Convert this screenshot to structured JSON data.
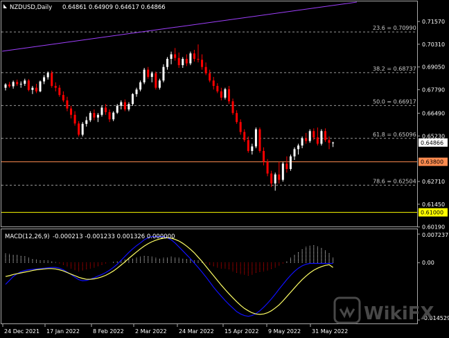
{
  "header": {
    "symbol": "NZDUSD,Daily",
    "ohlc": "0.64861 0.64909 0.64617 0.64866"
  },
  "macd_header": {
    "label": "MACD(12,26,9)",
    "values": "-0.000213 -0.001233 0.001326 0.000000"
  },
  "watermark": {
    "text": "WikiFX"
  },
  "colors": {
    "background": "#000000",
    "bull": "#ffffff",
    "bear": "#ff0000",
    "trendline": "#a040ff",
    "support": "#ff8c50",
    "support2": "#ffff00",
    "macd_line": "#1010ff",
    "signal_line": "#ffff66"
  },
  "chart_data": [
    {
      "type": "candlestick",
      "ylim": [
        0.61,
        0.716
      ],
      "price_axis_ticks": [
        {
          "value": 0.7157,
          "label": "0.71570"
        },
        {
          "value": 0.7031,
          "label": "0.70310"
        },
        {
          "value": 0.6905,
          "label": "0.69050"
        },
        {
          "value": 0.6779,
          "label": "0.67790"
        },
        {
          "value": 0.6649,
          "label": "0.66490"
        },
        {
          "value": 0.6523,
          "label": "0.65230"
        },
        {
          "value": 0.6271,
          "label": "0.62710"
        },
        {
          "value": 0.6145,
          "label": "0.61450"
        },
        {
          "value": 0.6019,
          "label": "0.60190"
        }
      ],
      "current_price": {
        "value": 0.64866,
        "label": "0.64866"
      },
      "fib_levels": [
        {
          "name": "23.6",
          "value": 0.7099,
          "label": "23.6 = 0.70990"
        },
        {
          "name": "38.2",
          "value": 0.68737,
          "label": "38.2 = 0.68737"
        },
        {
          "name": "50.0",
          "value": 0.66917,
          "label": "50.0 = 0.66917"
        },
        {
          "name": "61.8",
          "value": 0.65096,
          "label": "61.8 = 0.65096"
        },
        {
          "name": "78.6",
          "value": 0.62504,
          "label": "78.6 = 0.62504"
        }
      ],
      "horizontal_lines": [
        {
          "value": 0.638,
          "label": "0.63800"
        },
        {
          "value": 0.61,
          "label": "0.61000"
        }
      ],
      "x_labels": [
        "24 Dec 2021",
        "17 Jan 2022",
        "8 Feb 2022",
        "2 Mar 2022",
        "24 Mar 2022",
        "15 Apr 2022",
        "9 May 2022",
        "31 May 2022"
      ],
      "candles": [
        [
          0.679,
          0.6815,
          0.6775,
          0.6808
        ],
        [
          0.6808,
          0.6822,
          0.679,
          0.6798
        ],
        [
          0.6798,
          0.683,
          0.6785,
          0.6822
        ],
        [
          0.6822,
          0.6835,
          0.68,
          0.681
        ],
        [
          0.681,
          0.6825,
          0.679,
          0.6812
        ],
        [
          0.6812,
          0.684,
          0.68,
          0.683
        ],
        [
          0.683,
          0.6838,
          0.677,
          0.6778
        ],
        [
          0.6778,
          0.68,
          0.6755,
          0.679
        ],
        [
          0.679,
          0.6812,
          0.676,
          0.677
        ],
        [
          0.677,
          0.683,
          0.6765,
          0.6825
        ],
        [
          0.6825,
          0.686,
          0.681,
          0.6848
        ],
        [
          0.6848,
          0.688,
          0.6835,
          0.6872
        ],
        [
          0.6872,
          0.6885,
          0.679,
          0.68
        ],
        [
          0.68,
          0.682,
          0.677,
          0.679
        ],
        [
          0.679,
          0.6805,
          0.674,
          0.675
        ],
        [
          0.675,
          0.677,
          0.671,
          0.672
        ],
        [
          0.672,
          0.674,
          0.666,
          0.6675
        ],
        [
          0.6675,
          0.669,
          0.662,
          0.664
        ],
        [
          0.664,
          0.666,
          0.658,
          0.6592
        ],
        [
          0.6592,
          0.6605,
          0.652,
          0.653
        ],
        [
          0.653,
          0.66,
          0.652,
          0.659
        ],
        [
          0.659,
          0.663,
          0.6575,
          0.661
        ],
        [
          0.661,
          0.666,
          0.66,
          0.665
        ],
        [
          0.665,
          0.667,
          0.661,
          0.6625
        ],
        [
          0.6625,
          0.665,
          0.66,
          0.664
        ],
        [
          0.664,
          0.669,
          0.663,
          0.668
        ],
        [
          0.668,
          0.67,
          0.664,
          0.6655
        ],
        [
          0.6655,
          0.667,
          0.66,
          0.6615
        ],
        [
          0.6615,
          0.666,
          0.6605,
          0.6652
        ],
        [
          0.6652,
          0.67,
          0.6645,
          0.669
        ],
        [
          0.669,
          0.672,
          0.667,
          0.671
        ],
        [
          0.671,
          0.6725,
          0.666,
          0.667
        ],
        [
          0.667,
          0.671,
          0.666,
          0.67
        ],
        [
          0.67,
          0.676,
          0.669,
          0.6755
        ],
        [
          0.6755,
          0.679,
          0.674,
          0.678
        ],
        [
          0.678,
          0.683,
          0.677,
          0.682
        ],
        [
          0.682,
          0.69,
          0.681,
          0.689
        ],
        [
          0.689,
          0.6905,
          0.684,
          0.685
        ],
        [
          0.685,
          0.688,
          0.682,
          0.687
        ],
        [
          0.687,
          0.688,
          0.678,
          0.679
        ],
        [
          0.679,
          0.684,
          0.678,
          0.683
        ],
        [
          0.683,
          0.692,
          0.682,
          0.6905
        ],
        [
          0.6905,
          0.696,
          0.689,
          0.695
        ],
        [
          0.695,
          0.699,
          0.692,
          0.6975
        ],
        [
          0.6975,
          0.701,
          0.694,
          0.6955
        ],
        [
          0.6955,
          0.6985,
          0.69,
          0.6915
        ],
        [
          0.6915,
          0.696,
          0.69,
          0.695
        ],
        [
          0.695,
          0.6975,
          0.691,
          0.6925
        ],
        [
          0.6925,
          0.699,
          0.6915,
          0.698
        ],
        [
          0.698,
          0.7,
          0.6935,
          0.695
        ],
        [
          0.695,
          0.703,
          0.693,
          0.6945
        ],
        [
          0.6945,
          0.6975,
          0.689,
          0.6905
        ],
        [
          0.6905,
          0.693,
          0.686,
          0.687
        ],
        [
          0.687,
          0.689,
          0.682,
          0.683
        ],
        [
          0.683,
          0.685,
          0.678,
          0.68
        ],
        [
          0.68,
          0.6815,
          0.676,
          0.677
        ],
        [
          0.677,
          0.679,
          0.672,
          0.6735
        ],
        [
          0.6735,
          0.679,
          0.6725,
          0.6782
        ],
        [
          0.6782,
          0.68,
          0.67,
          0.6715
        ],
        [
          0.6715,
          0.673,
          0.664,
          0.665
        ],
        [
          0.665,
          0.6665,
          0.659,
          0.66
        ],
        [
          0.66,
          0.6615,
          0.653,
          0.6545
        ],
        [
          0.6545,
          0.656,
          0.649,
          0.65
        ],
        [
          0.65,
          0.652,
          0.643,
          0.644
        ],
        [
          0.644,
          0.648,
          0.642,
          0.6465
        ],
        [
          0.6465,
          0.657,
          0.6455,
          0.656
        ],
        [
          0.656,
          0.657,
          0.643,
          0.644
        ],
        [
          0.644,
          0.646,
          0.636,
          0.638
        ],
        [
          0.638,
          0.6395,
          0.63,
          0.6315
        ],
        [
          0.6315,
          0.633,
          0.624,
          0.626
        ],
        [
          0.626,
          0.632,
          0.622,
          0.631
        ],
        [
          0.631,
          0.638,
          0.626,
          0.628
        ],
        [
          0.628,
          0.638,
          0.627,
          0.637
        ],
        [
          0.637,
          0.641,
          0.632,
          0.634
        ],
        [
          0.634,
          0.642,
          0.633,
          0.641
        ],
        [
          0.641,
          0.646,
          0.639,
          0.645
        ],
        [
          0.645,
          0.648,
          0.642,
          0.647
        ],
        [
          0.647,
          0.652,
          0.6455,
          0.651
        ],
        [
          0.651,
          0.654,
          0.648,
          0.6495
        ],
        [
          0.6495,
          0.656,
          0.6485,
          0.655
        ],
        [
          0.655,
          0.6565,
          0.65,
          0.6515
        ],
        [
          0.6515,
          0.657,
          0.647,
          0.648
        ],
        [
          0.648,
          0.656,
          0.647,
          0.655
        ],
        [
          0.655,
          0.6565,
          0.649,
          0.65
        ],
        [
          0.65,
          0.652,
          0.645,
          0.6485
        ],
        [
          0.64861,
          0.64909,
          0.64617,
          0.64866
        ]
      ]
    },
    {
      "type": "macd",
      "ylim": [
        -0.014529,
        0.007237
      ],
      "axis_labels": [
        {
          "value": 0.007237,
          "label": "0.007237"
        },
        {
          "value": 0.0,
          "label": "0.00"
        },
        {
          "value": -0.014529,
          "label": "-0.014529"
        }
      ],
      "histogram": [
        0.0023,
        0.0022,
        0.0021,
        0.002,
        0.0018,
        0.0016,
        0.0013,
        0.001,
        0.0008,
        0.0007,
        0.0006,
        0.0005,
        0.0004,
        0.0001,
        -0.0003,
        -0.0007,
        -0.0011,
        -0.0015,
        -0.0019,
        -0.0022,
        -0.0021,
        -0.0018,
        -0.0015,
        -0.0012,
        -0.0009,
        -0.0006,
        -0.0003,
        0,
        0.0002,
        0.0004,
        0.0006,
        0.0008,
        0.0009,
        0.0011,
        0.0013,
        0.0015,
        0.0018,
        0.0017,
        0.0015,
        0.0012,
        0.0011,
        0.0012,
        0.0014,
        0.0015,
        0.0014,
        0.0012,
        0.0011,
        0.001,
        0.0009,
        0.0007,
        0.0005,
        0.0002,
        -0.0002,
        -0.0006,
        -0.0009,
        -0.0012,
        -0.0015,
        -0.0015,
        -0.0018,
        -0.0022,
        -0.0026,
        -0.0029,
        -0.0031,
        -0.0033,
        -0.0031,
        -0.0026,
        -0.0024,
        -0.0022,
        -0.002,
        -0.0017,
        -0.0012,
        -0.0008,
        -0.0003,
        0.0004,
        0.0012,
        0.002,
        0.0028,
        0.0035,
        0.004,
        0.0043,
        0.0044,
        0.0042,
        0.0038,
        0.0032,
        0.0025,
        0.0013
      ],
      "macd": [
        -0.0055,
        -0.0045,
        -0.0035,
        -0.0028,
        -0.0023,
        -0.002,
        -0.0018,
        -0.0017,
        -0.0016,
        -0.0015,
        -0.0014,
        -0.0013,
        -0.0012,
        -0.0012,
        -0.0014,
        -0.0018,
        -0.0024,
        -0.003,
        -0.0037,
        -0.0043,
        -0.0046,
        -0.0045,
        -0.0042,
        -0.0038,
        -0.0034,
        -0.003,
        -0.0025,
        -0.0019,
        -0.0012,
        -0.0004,
        0.0006,
        0.0016,
        0.0026,
        0.0035,
        0.0043,
        0.005,
        0.0058,
        0.0063,
        0.0066,
        0.0066,
        0.0066,
        0.0066,
        0.0063,
        0.0058,
        0.005,
        0.004,
        0.003,
        0.002,
        0.001,
        -0.0001,
        -0.0012,
        -0.0024,
        -0.0036,
        -0.0049,
        -0.0062,
        -0.0074,
        -0.0085,
        -0.0096,
        -0.0106,
        -0.0115,
        -0.0124,
        -0.013,
        -0.0134,
        -0.0136,
        -0.0134,
        -0.0129,
        -0.0122,
        -0.0113,
        -0.0103,
        -0.0092,
        -0.008,
        -0.0067,
        -0.0055,
        -0.0043,
        -0.0032,
        -0.0022,
        -0.0014,
        -0.0008,
        -0.0004,
        -0.0002,
        -0.0002,
        -0.0002,
        -0.0002,
        -0.0002,
        -0.0002,
        -0.0002
      ],
      "signal": [
        -0.0035,
        -0.0033,
        -0.003,
        -0.0028,
        -0.0026,
        -0.0024,
        -0.0022,
        -0.002,
        -0.0018,
        -0.0017,
        -0.0016,
        -0.0015,
        -0.0015,
        -0.0016,
        -0.0018,
        -0.0021,
        -0.0025,
        -0.0029,
        -0.0033,
        -0.0037,
        -0.004,
        -0.0042,
        -0.0042,
        -0.0041,
        -0.0039,
        -0.0036,
        -0.0032,
        -0.0027,
        -0.0021,
        -0.0014,
        -0.0006,
        0.0002,
        0.0011,
        0.0019,
        0.0027,
        0.0035,
        0.0042,
        0.0048,
        0.0053,
        0.0057,
        0.006,
        0.0062,
        0.0063,
        0.0062,
        0.0059,
        0.0055,
        0.0049,
        0.0042,
        0.0034,
        0.0025,
        0.0014,
        0.0003,
        -0.0009,
        -0.0021,
        -0.0033,
        -0.0045,
        -0.0057,
        -0.0068,
        -0.0079,
        -0.0089,
        -0.0099,
        -0.0108,
        -0.0116,
        -0.0122,
        -0.0127,
        -0.013,
        -0.0131,
        -0.013,
        -0.0127,
        -0.0122,
        -0.0115,
        -0.0107,
        -0.0097,
        -0.0086,
        -0.0075,
        -0.0064,
        -0.0053,
        -0.0043,
        -0.0034,
        -0.0026,
        -0.0019,
        -0.0014,
        -0.001,
        -0.0007,
        -0.0005,
        -0.0012
      ]
    }
  ]
}
